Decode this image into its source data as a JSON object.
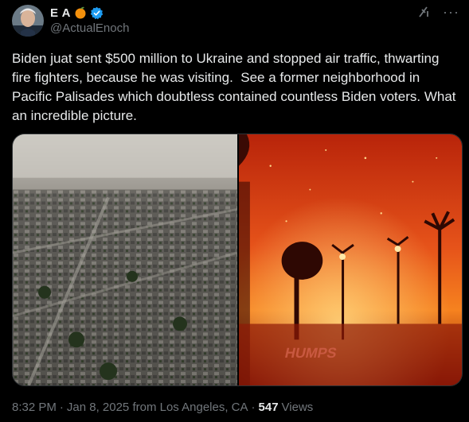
{
  "author": {
    "display_name": "E A",
    "handle": "@ActualEnoch",
    "verified": true,
    "emoji": "orange-emoji-icon"
  },
  "header_icons": [
    "grok-icon",
    "more-icon"
  ],
  "tweet": {
    "text": "Biden juat sent $500 million to Ukraine and stopped air traffic, thwarting fire fighters, because he was visiting.  See a former neighborhood in Pacific Palisades which doubtless contained countless Biden voters. What an incredible picture."
  },
  "media": {
    "images": [
      "burned-neighborhood-aerial-photo",
      "wildfire-night-photo"
    ],
    "overlay_text": "HUMPS"
  },
  "meta": {
    "time": "8:32 PM",
    "sep1": "·",
    "date": "Jan 8, 2025 from Los Angeles, CA",
    "sep2": "·",
    "views": "547",
    "views_label": "Views"
  },
  "colors": {
    "background": "#000000",
    "text": "#e7e9ea",
    "secondary": "#71767b",
    "verified": "#1d9bf0"
  }
}
